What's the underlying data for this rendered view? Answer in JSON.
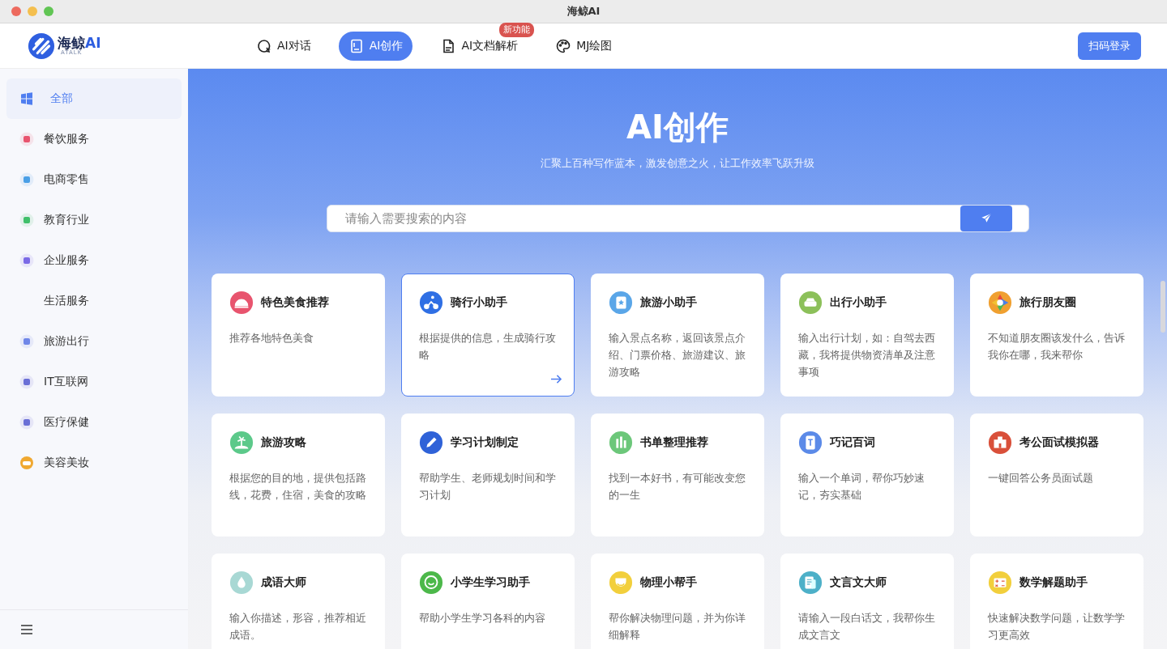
{
  "window": {
    "title": "海鲸AI"
  },
  "logo": {
    "name": "海鲸",
    "suffix": "AI",
    "tagline": "ATALK"
  },
  "nav_tabs": [
    {
      "label": "AI对话",
      "selected": false
    },
    {
      "label": "AI创作",
      "selected": true
    },
    {
      "label": "AI文档解析",
      "selected": false,
      "badge": "新功能"
    },
    {
      "label": "MJ绘图",
      "selected": false
    }
  ],
  "login_button": "扫码登录",
  "sidebar": {
    "items": [
      {
        "label": "全部",
        "selected": true,
        "color": "#4f7ef0"
      },
      {
        "label": "餐饮服务",
        "selected": false,
        "color": "#e8546e"
      },
      {
        "label": "电商零售",
        "selected": false,
        "color": "#4a9fe6"
      },
      {
        "label": "教育行业",
        "selected": false,
        "color": "#3fbf6a"
      },
      {
        "label": "企业服务",
        "selected": false,
        "color": "#7b6ae6"
      },
      {
        "label": "生活服务",
        "selected": false
      },
      {
        "label": "旅游出行",
        "selected": false,
        "color": "#6f86e8"
      },
      {
        "label": "IT互联网",
        "selected": false,
        "color": "#6a6fd6"
      },
      {
        "label": "医疗保健",
        "selected": false,
        "color": "#6a6fd6"
      },
      {
        "label": "美容美妆",
        "selected": false,
        "color": "#f0a830"
      }
    ]
  },
  "hero": {
    "title": "AI创作",
    "subtitle": "汇聚上百种写作蓝本，激发创意之火，让工作效率飞跃升级"
  },
  "search": {
    "placeholder": "请输入需要搜索的内容"
  },
  "cards": [
    {
      "title": "特色美食推荐",
      "description": "推荐各地特色美食",
      "color": "#e8546e",
      "selected": false
    },
    {
      "title": "骑行小助手",
      "description": "根据提供的信息，生成骑行攻略",
      "color": "#2f6fe4",
      "selected": true
    },
    {
      "title": "旅游小助手",
      "description": "输入景点名称，返回该景点介绍、门票价格、旅游建议、旅游攻略",
      "color": "#5aa6e8",
      "selected": false
    },
    {
      "title": "出行小助手",
      "description": "输入出行计划，如：自驾去西藏，我将提供物资清单及注意事项",
      "color": "#8cc05a",
      "selected": false
    },
    {
      "title": "旅行朋友圈",
      "description": "不知道朋友圈该发什么，告诉我你在哪，我来帮你",
      "color": "#f0a030",
      "selected": false
    },
    {
      "title": "旅游攻略",
      "description": "根据您的目的地，提供包括路线，花费，住宿，美食的攻略",
      "color": "#5cc98a",
      "selected": false
    },
    {
      "title": "学习计划制定",
      "description": "帮助学生、老师规划时间和学习计划",
      "color": "#2f62d8",
      "selected": false
    },
    {
      "title": "书单整理推荐",
      "description": "找到一本好书，有可能改变您的一生",
      "color": "#6cc77a",
      "selected": false
    },
    {
      "title": "巧记百词",
      "description": "输入一个单词，帮你巧妙速记，夯实基础",
      "color": "#5b8ae8",
      "selected": false
    },
    {
      "title": "考公面试模拟器",
      "description": "一键回答公务员面试题",
      "color": "#d9503a",
      "selected": false
    },
    {
      "title": "成语大师",
      "description": "输入你描述，形容，推荐相近成语。",
      "color": "#a8d8d4",
      "selected": false
    },
    {
      "title": "小学生学习助手",
      "description": "帮助小学生学习各科的内容",
      "color": "#4cb84a",
      "selected": false
    },
    {
      "title": "物理小帮手",
      "description": "帮你解决物理问题，并为你详细解释",
      "color": "#f2cf3c",
      "selected": false
    },
    {
      "title": "文言文大师",
      "description": "请输入一段白话文，我帮你生成文言文",
      "color": "#4db0c8",
      "selected": false
    },
    {
      "title": "数学解题助手",
      "description": "快速解决数学问题，让数学学习更高效",
      "color": "#f2cf3c",
      "selected": false
    }
  ]
}
